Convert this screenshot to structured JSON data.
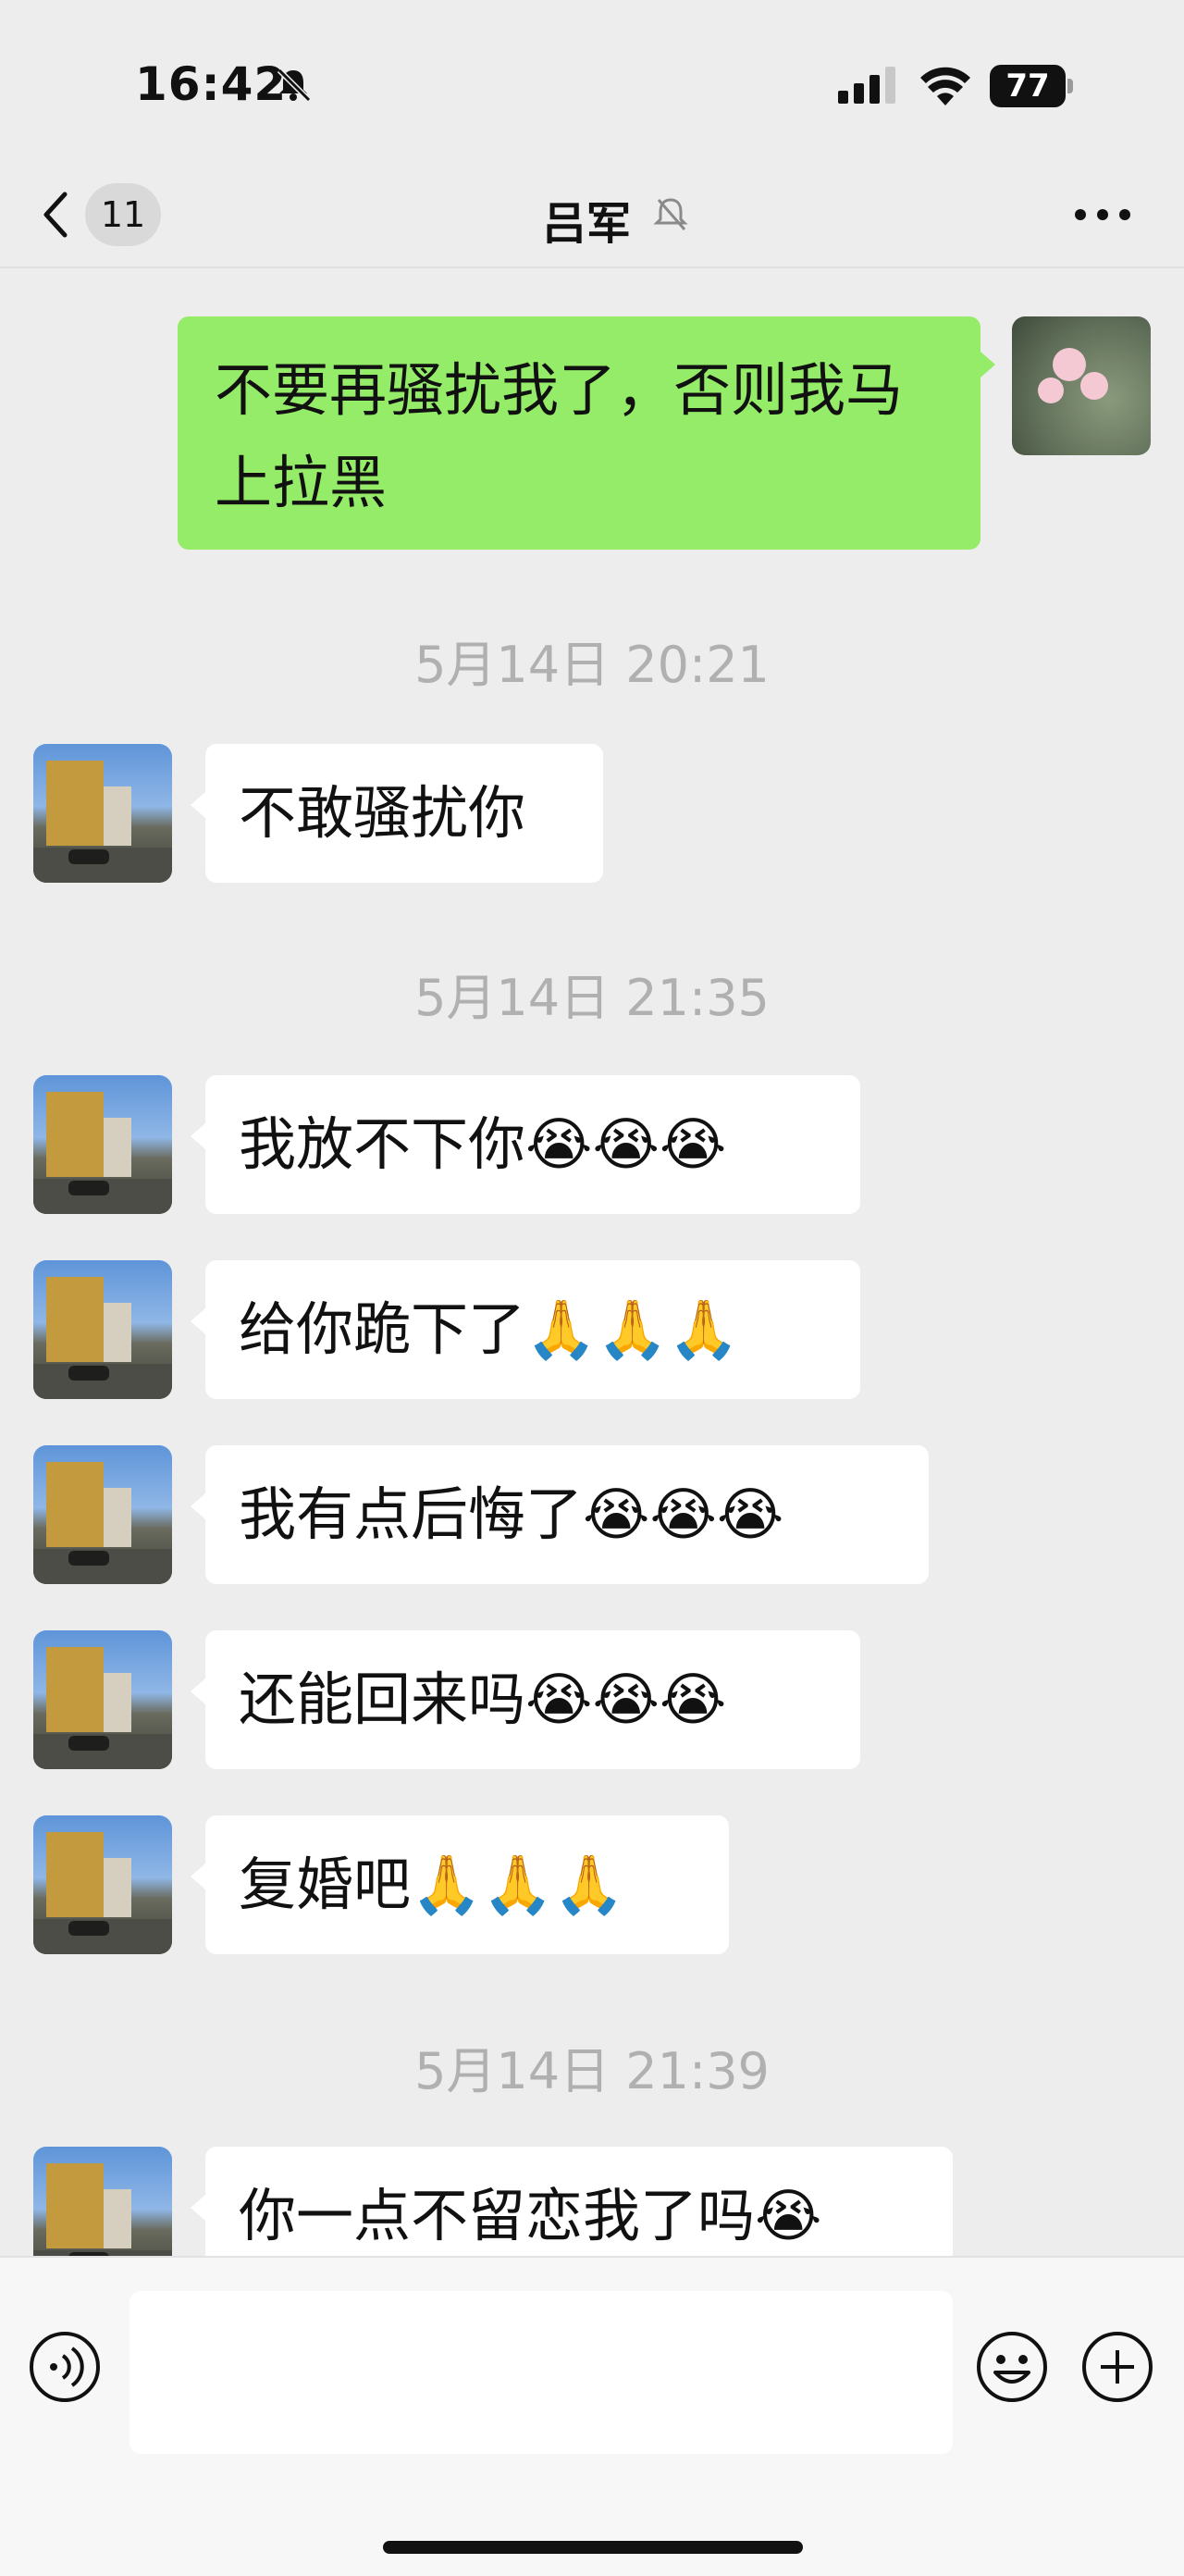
{
  "status_bar": {
    "time": "16:42",
    "battery": "77"
  },
  "nav": {
    "unread_count": "11",
    "title": "吕军",
    "icons": [
      "back-chevron-icon",
      "mute-bell-icon",
      "more-icon"
    ]
  },
  "messages": [
    {
      "type": "sent",
      "text": "不要再骚扰我了，否则我马上拉黑"
    },
    {
      "type": "timestamp",
      "text": "5月14日 20:21"
    },
    {
      "type": "received",
      "text": "不敢骚扰你"
    },
    {
      "type": "timestamp",
      "text": "5月14日 21:35"
    },
    {
      "type": "received",
      "text": "我放不下你😭😭😭"
    },
    {
      "type": "received",
      "text": "给你跪下了🙏🙏🙏"
    },
    {
      "type": "received",
      "text": "我有点后悔了😭😭😭"
    },
    {
      "type": "received",
      "text": "还能回来吗😭😭😭"
    },
    {
      "type": "received",
      "text": "复婚吧🙏🙏🙏"
    },
    {
      "type": "timestamp",
      "text": "5月14日 21:39"
    },
    {
      "type": "received",
      "text": "你一点不留恋我了吗😭"
    }
  ],
  "input_bar": {
    "icons": [
      "voice-icon",
      "emoji-icon",
      "plus-icon"
    ],
    "text": ""
  }
}
